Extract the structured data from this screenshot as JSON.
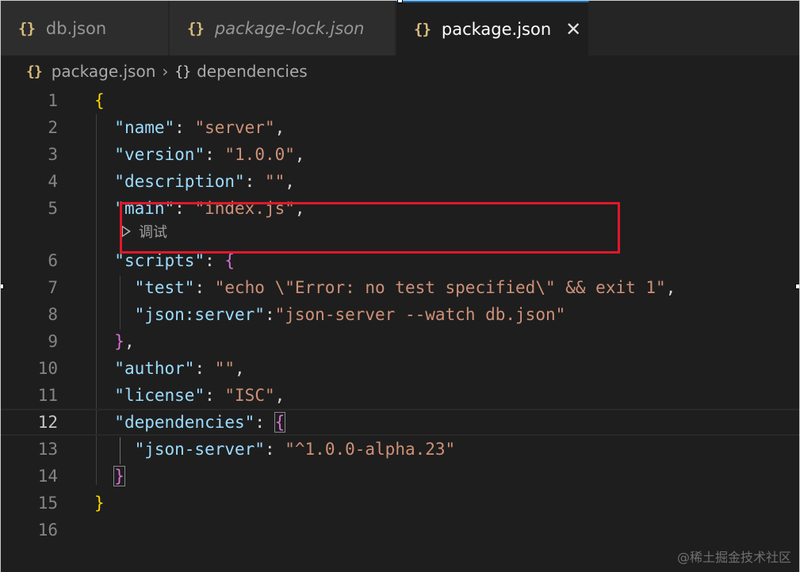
{
  "tabs": [
    {
      "icon": "{}",
      "label": "db.json",
      "italic": false,
      "active": false
    },
    {
      "icon": "{}",
      "label": "package-lock.json",
      "italic": true,
      "active": false
    },
    {
      "icon": "{}",
      "label": "package.json",
      "italic": false,
      "active": true,
      "close": "✕"
    }
  ],
  "breadcrumb": {
    "items": [
      {
        "icon": "{}",
        "label": "package.json"
      },
      {
        "icon": "{}",
        "label": "dependencies"
      }
    ],
    "separator": "›"
  },
  "codelens": {
    "label": "调试"
  },
  "lines": [
    {
      "num": "1",
      "tokens": [
        {
          "c": "b1",
          "t": "{"
        }
      ]
    },
    {
      "num": "2",
      "tokens": [
        {
          "c": "p",
          "t": "  "
        },
        {
          "c": "k",
          "t": "\"name\""
        },
        {
          "c": "p",
          "t": ": "
        },
        {
          "c": "s",
          "t": "\"server\""
        },
        {
          "c": "p",
          "t": ","
        }
      ]
    },
    {
      "num": "3",
      "tokens": [
        {
          "c": "p",
          "t": "  "
        },
        {
          "c": "k",
          "t": "\"version\""
        },
        {
          "c": "p",
          "t": ": "
        },
        {
          "c": "s",
          "t": "\"1.0.0\""
        },
        {
          "c": "p",
          "t": ","
        }
      ]
    },
    {
      "num": "4",
      "tokens": [
        {
          "c": "p",
          "t": "  "
        },
        {
          "c": "k",
          "t": "\"description\""
        },
        {
          "c": "p",
          "t": ": "
        },
        {
          "c": "s",
          "t": "\"\""
        },
        {
          "c": "p",
          "t": ","
        }
      ]
    },
    {
      "num": "5",
      "tokens": [
        {
          "c": "p",
          "t": "  "
        },
        {
          "c": "k",
          "t": "\"main\""
        },
        {
          "c": "p",
          "t": ": "
        },
        {
          "c": "s",
          "t": "\"index.js\""
        },
        {
          "c": "p",
          "t": ","
        }
      ]
    },
    {
      "num": "6",
      "tokens": [
        {
          "c": "p",
          "t": "  "
        },
        {
          "c": "k",
          "t": "\"scripts\""
        },
        {
          "c": "p",
          "t": ": "
        },
        {
          "c": "b2",
          "t": "{"
        }
      ]
    },
    {
      "num": "7",
      "tokens": [
        {
          "c": "p",
          "t": "    "
        },
        {
          "c": "k",
          "t": "\"test\""
        },
        {
          "c": "p",
          "t": ": "
        },
        {
          "c": "s",
          "t": "\"echo \\\"Error: no test specified\\\" && exit 1\""
        },
        {
          "c": "p",
          "t": ","
        }
      ]
    },
    {
      "num": "8",
      "tokens": [
        {
          "c": "p",
          "t": "    "
        },
        {
          "c": "k",
          "t": "\"json:server\""
        },
        {
          "c": "p",
          "t": ":"
        },
        {
          "c": "s",
          "t": "\"json-server --watch db.json\""
        }
      ]
    },
    {
      "num": "9",
      "tokens": [
        {
          "c": "p",
          "t": "  "
        },
        {
          "c": "b2",
          "t": "}"
        },
        {
          "c": "p",
          "t": ","
        }
      ]
    },
    {
      "num": "10",
      "tokens": [
        {
          "c": "p",
          "t": "  "
        },
        {
          "c": "k",
          "t": "\"author\""
        },
        {
          "c": "p",
          "t": ": "
        },
        {
          "c": "s",
          "t": "\"\""
        },
        {
          "c": "p",
          "t": ","
        }
      ]
    },
    {
      "num": "11",
      "tokens": [
        {
          "c": "p",
          "t": "  "
        },
        {
          "c": "k",
          "t": "\"license\""
        },
        {
          "c": "p",
          "t": ": "
        },
        {
          "c": "s",
          "t": "\"ISC\""
        },
        {
          "c": "p",
          "t": ","
        }
      ]
    },
    {
      "num": "12",
      "tokens": [
        {
          "c": "p",
          "t": "  "
        },
        {
          "c": "k",
          "t": "\"dependencies\""
        },
        {
          "c": "p",
          "t": ": "
        },
        {
          "c": "b2 bracket-match",
          "t": "{"
        }
      ]
    },
    {
      "num": "13",
      "tokens": [
        {
          "c": "p",
          "t": "    "
        },
        {
          "c": "k",
          "t": "\"json-server\""
        },
        {
          "c": "p",
          "t": ": "
        },
        {
          "c": "s",
          "t": "\"^1.0.0-alpha.23\""
        }
      ]
    },
    {
      "num": "14",
      "tokens": [
        {
          "c": "p",
          "t": "  "
        },
        {
          "c": "b2 bracket-match",
          "t": "}"
        }
      ]
    },
    {
      "num": "15",
      "tokens": [
        {
          "c": "b1",
          "t": "}"
        }
      ]
    },
    {
      "num": "16",
      "tokens": []
    }
  ],
  "current_line": "12",
  "watermark": "@稀土掘金技术社区",
  "colors": {
    "key": "#9cdcfe",
    "string": "#ce9178",
    "bracket_level1": "#ffd700",
    "bracket_level2": "#da70d6",
    "highlight_box": "#e0182a",
    "active_tab_border": "#0e70c0"
  }
}
